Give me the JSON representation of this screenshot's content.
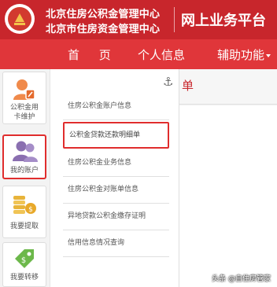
{
  "header": {
    "org_name_line1": "北京住房公积金管理中心",
    "org_name_line2": "北京市住房资金管理中心",
    "site_title": "网上业务平台"
  },
  "nav": {
    "items": [
      {
        "label": "首 页"
      },
      {
        "label": "个人信息"
      },
      {
        "label": "辅助功能"
      }
    ]
  },
  "sidebar": {
    "items": [
      {
        "label": "公积金用卡维护",
        "icon": "user-card-icon",
        "active": false
      },
      {
        "label": "我的账户",
        "icon": "users-icon",
        "active": true
      },
      {
        "label": "我要提取",
        "icon": "coins-icon",
        "active": false
      },
      {
        "label": "我要转移",
        "icon": "tag-icon",
        "active": false
      }
    ]
  },
  "menu": {
    "items": [
      {
        "label": "住房公积金账户信息"
      },
      {
        "label": "公积金贷款还款明细单",
        "highlighted": true
      },
      {
        "label": "住房公积金业务信息"
      },
      {
        "label": "住房公积金对账单信息"
      },
      {
        "label": "异地贷款公积金缴存证明"
      },
      {
        "label": "信用信息情况查询"
      }
    ]
  },
  "tab": {
    "partial_label": "单",
    "pin_icon": "anchor-icon"
  },
  "watermark": "头条 @自住房管家",
  "colors": {
    "header_red": "#c8262c",
    "nav_red": "#e0363a",
    "highlight_red": "#e02d2d",
    "icon_orange": "#f08a4b",
    "icon_purple": "#8a6fb0",
    "icon_gold": "#e8b43a",
    "icon_green": "#6cb84a"
  }
}
